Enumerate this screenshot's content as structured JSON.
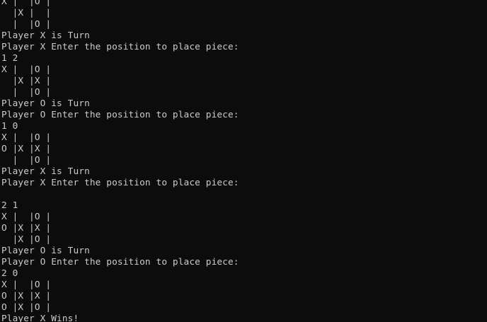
{
  "console": {
    "lines": [
      "X |  |O |",
      "  |X |  |",
      "  |  |O |",
      "Player X is Turn",
      "Player X Enter the position to place piece:",
      "1 2",
      "X |  |O |",
      "  |X |X |",
      "  |  |O |",
      "Player O is Turn",
      "Player O Enter the position to place piece:",
      "1 0",
      "X |  |O |",
      "O |X |X |",
      "  |  |O |",
      "Player X is Turn",
      "Player X Enter the position to place piece:",
      "",
      "2 1",
      "X |  |O |",
      "O |X |X |",
      "  |X |O |",
      "Player O is Turn",
      "Player O Enter the position to place piece:",
      "2 0",
      "X |  |O |",
      "O |X |X |",
      "O |X |O |",
      "Player X Wins!"
    ]
  }
}
